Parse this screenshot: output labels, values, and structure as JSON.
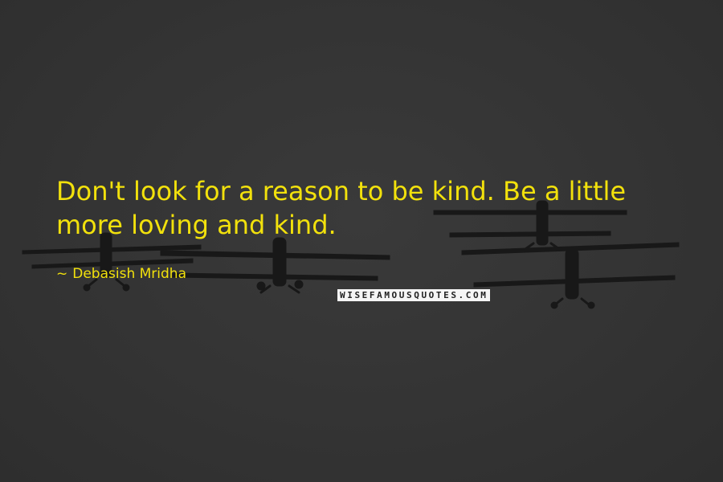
{
  "quote": {
    "text": "Don't look for a reason to be kind. Be a little more loving and kind.",
    "author_prefix": "~",
    "author": "Debasish Mridha"
  },
  "watermark": {
    "text": "WISEFAMOUSQUOTES.COM"
  },
  "background": {
    "color": "#343434",
    "image_subject": "biplanes-in-formation"
  },
  "colors": {
    "quote_text": "#f2e10c",
    "plane_silhouette": "#161616"
  }
}
